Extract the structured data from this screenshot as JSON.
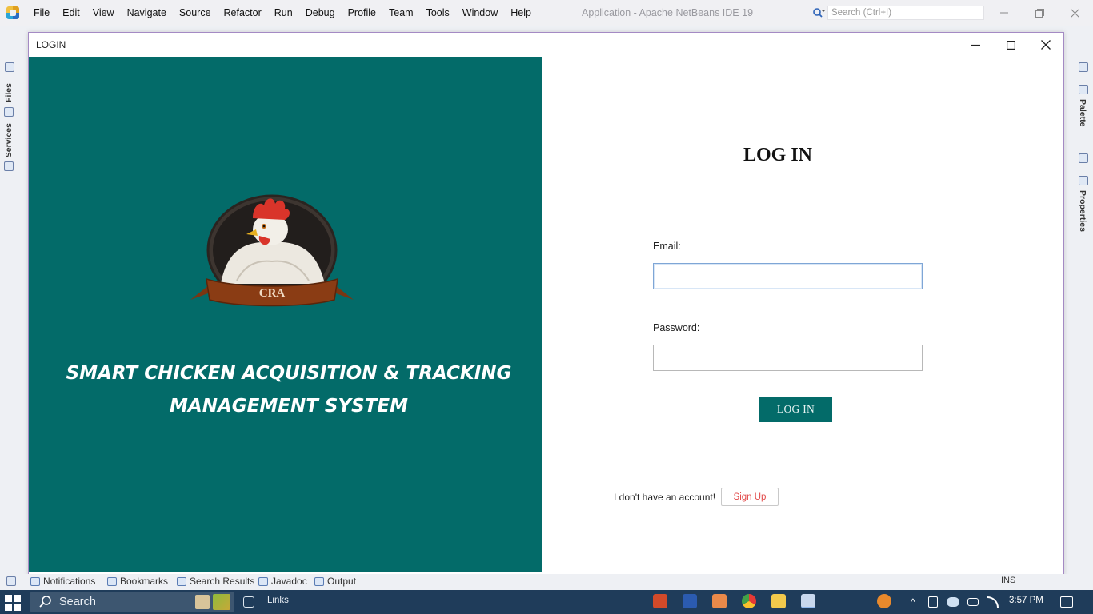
{
  "ide": {
    "menu": [
      "File",
      "Edit",
      "View",
      "Navigate",
      "Source",
      "Refactor",
      "Run",
      "Debug",
      "Profile",
      "Team",
      "Tools",
      "Window",
      "Help"
    ],
    "title": "Application - Apache NetBeans IDE 19",
    "search_placeholder": "Search (Ctrl+I)",
    "left_tabs": {
      "files": "Files",
      "services": "Services"
    },
    "right_tabs": {
      "palette": "Palette",
      "properties": "Properties"
    },
    "bottom_tabs": {
      "notifications": "Notifications",
      "bookmarks": "Bookmarks",
      "search_results": "Search Results",
      "javadoc": "Javadoc",
      "output": "Output"
    },
    "status_mode": "INS"
  },
  "login_window": {
    "title": "LOGIN",
    "logo_text": "CRA",
    "system_title_line1": "SMART CHICKEN ACQUISITION & TRACKING",
    "system_title_line2": "MANAGEMENT SYSTEM",
    "heading": "LOG IN",
    "email_label": "Email:",
    "email_value": "",
    "password_label": "Password:",
    "password_value": "",
    "login_button": "LOG IN",
    "no_account_text": "I don't have an account!",
    "signup_button": "Sign Up",
    "colors": {
      "panel": "#036b69",
      "signup_text": "#e24a4a"
    }
  },
  "taskbar": {
    "search_label": "Search",
    "links_label": "Links",
    "time": "3:57 PM"
  }
}
